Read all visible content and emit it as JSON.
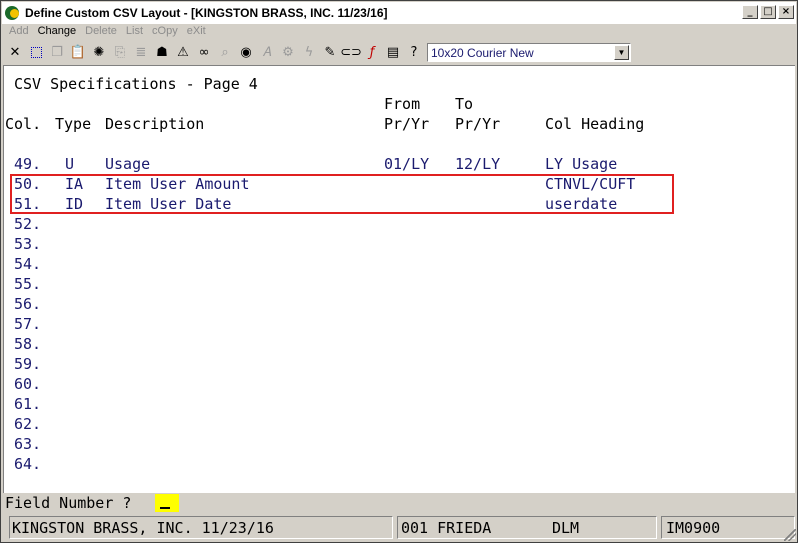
{
  "window": {
    "title": "Define Custom CSV Layout - [KINGSTON BRASS, INC. 11/23/16]",
    "controls": {
      "minimize": "_",
      "maximize": "□",
      "close": "×"
    }
  },
  "menu": [
    {
      "label": "Add",
      "enabled": false
    },
    {
      "label": "Change",
      "enabled": true
    },
    {
      "label": "Delete",
      "enabled": false
    },
    {
      "label": "List",
      "enabled": false
    },
    {
      "label": "cOpy",
      "enabled": false
    },
    {
      "label": "eXit",
      "enabled": false
    }
  ],
  "toolbar": {
    "icons": [
      "close-icon",
      "select-icon",
      "copy-icon",
      "paste-icon",
      "settings-icon",
      "export-icon",
      "list-icon",
      "user-icon",
      "warning-icon",
      "binoculars-icon",
      "zoom-icon",
      "globe-icon",
      "font-icon",
      "gear-icon",
      "flash-icon",
      "edit-icon",
      "link-icon",
      "function-icon",
      "notes-icon",
      "help-icon"
    ],
    "font_select": {
      "value": "10x20 Courier New"
    }
  },
  "screen": {
    "title": "CSV Specifications - Page 4",
    "headers": {
      "from_label": "From",
      "to_label": "To",
      "col": "Col.",
      "type": "Type",
      "description": "Description",
      "from": "Pr/Yr",
      "to": "Pr/Yr",
      "col_heading": "Col Heading"
    },
    "rows": [
      {
        "num": "49.",
        "type": "U",
        "description": "Usage",
        "from": "01/LY",
        "to": "12/LY",
        "heading": "LY Usage"
      },
      {
        "num": "50.",
        "type": "IA",
        "description": "Item User Amount",
        "from": "",
        "to": "",
        "heading": "CTNVL/CUFT"
      },
      {
        "num": "51.",
        "type": "ID",
        "description": "Item User Date",
        "from": "",
        "to": "",
        "heading": "userdate"
      },
      {
        "num": "52."
      },
      {
        "num": "53."
      },
      {
        "num": "54."
      },
      {
        "num": "55."
      },
      {
        "num": "56."
      },
      {
        "num": "57."
      },
      {
        "num": "58."
      },
      {
        "num": "59."
      },
      {
        "num": "60."
      },
      {
        "num": "61."
      },
      {
        "num": "62."
      },
      {
        "num": "63."
      },
      {
        "num": "64."
      }
    ]
  },
  "prompt": {
    "label": "Field Number ?",
    "value": ""
  },
  "status": {
    "company": "KINGSTON BRASS, INC. 11/23/16",
    "user": "001 FRIEDA",
    "code": "DLM",
    "program": "IM0900"
  },
  "colors": {
    "highlight_border": "#e02020",
    "input_bg": "#ffff00",
    "text_blue": "#1a1a6e"
  }
}
